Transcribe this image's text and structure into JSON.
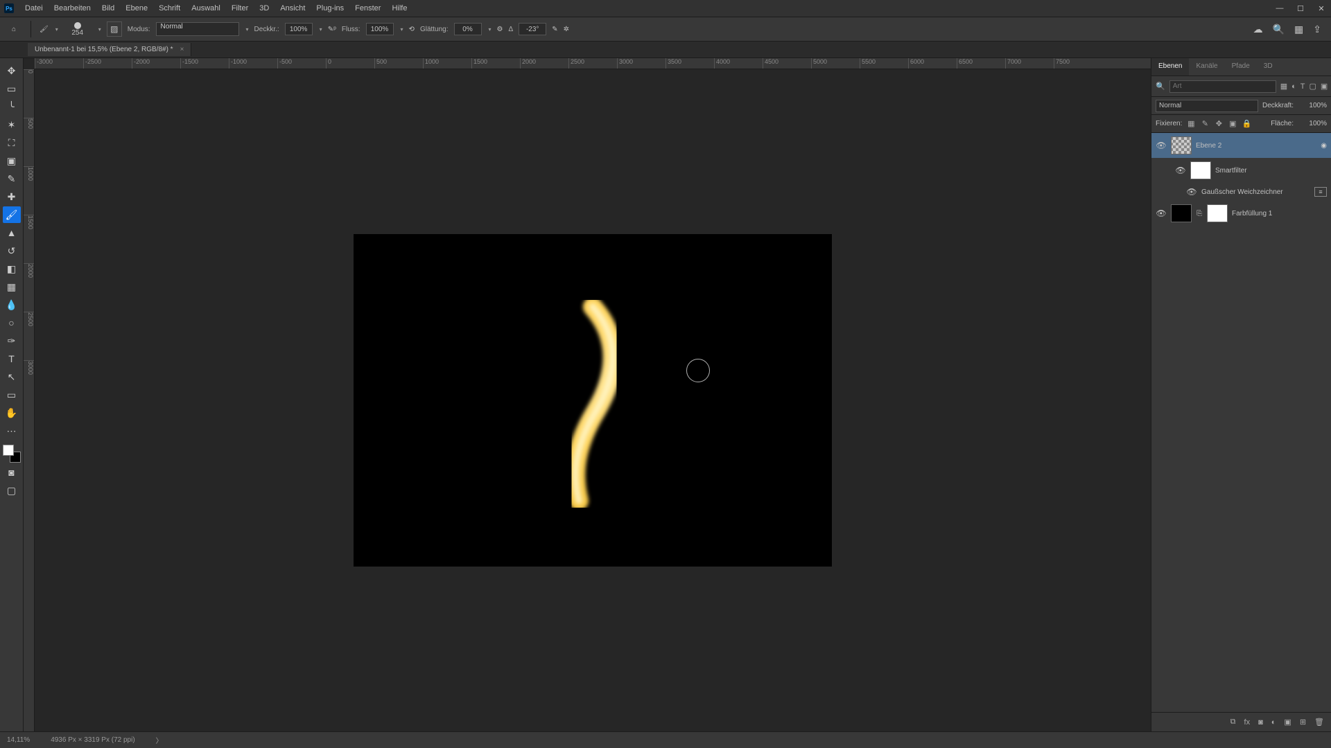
{
  "menu": {
    "items": [
      "Datei",
      "Bearbeiten",
      "Bild",
      "Ebene",
      "Schrift",
      "Auswahl",
      "Filter",
      "3D",
      "Ansicht",
      "Plug-ins",
      "Fenster",
      "Hilfe"
    ]
  },
  "options": {
    "brush_size": "254",
    "mode_label": "Modus:",
    "mode_value": "Normal",
    "opacity_label": "Deckkr.:",
    "opacity_value": "100%",
    "flow_label": "Fluss:",
    "flow_value": "100%",
    "smoothing_label": "Glättung:",
    "smoothing_value": "0%",
    "angle_label": "Δ",
    "angle_value": "-23°"
  },
  "doc": {
    "tab_title": "Unbenannt-1 bei 15,5% (Ebene 2, RGB/8#) *"
  },
  "ruler_h": [
    "-3000",
    "-2500",
    "-2000",
    "-1500",
    "-1000",
    "-500",
    "0",
    "500",
    "1000",
    "1500",
    "2000",
    "2500",
    "3000",
    "3500",
    "4000",
    "4500",
    "5000",
    "5500",
    "6000",
    "6500",
    "7000",
    "7500"
  ],
  "ruler_v": [
    "0",
    "500",
    "1000",
    "1500",
    "2000",
    "2500",
    "3000"
  ],
  "panels": {
    "tabs": [
      "Ebenen",
      "Kanäle",
      "Pfade",
      "3D"
    ],
    "search_placeholder": "Art",
    "blend_label": "Normal",
    "opacity_label": "Deckkraft:",
    "opacity_value": "100%",
    "lock_label": "Fixieren:",
    "fill_label": "Fläche:",
    "fill_value": "100%",
    "layers": {
      "l1_name": "Ebene 2",
      "l2_name": "Smartfilter",
      "l3_name": "Gaußscher Weichzeichner",
      "l4_name": "Farbfüllung 1"
    }
  },
  "status": {
    "zoom": "14,11%",
    "docinfo": "4936 Px × 3319 Px (72 ppi)"
  }
}
